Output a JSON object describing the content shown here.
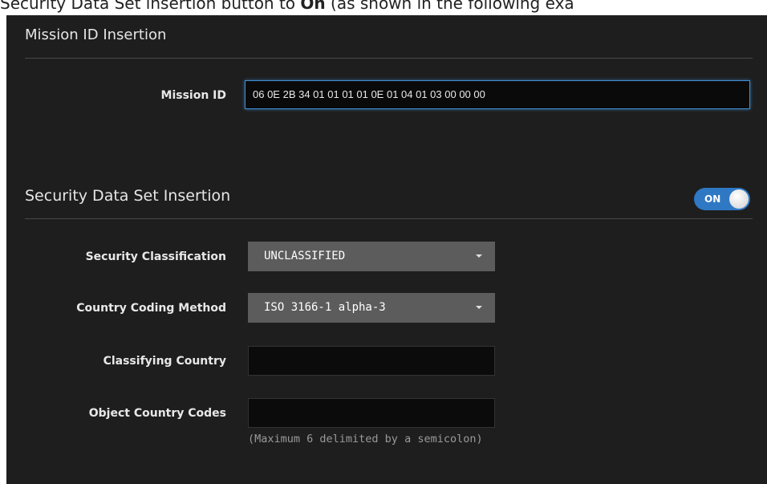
{
  "doc_caption": {
    "prefix": "Security Data Set insertion button to ",
    "bold": "On",
    "suffix": " (as shown in the following exa"
  },
  "mission_section": {
    "title": "Mission ID Insertion",
    "mission_id_label": "Mission ID",
    "mission_id_value": "06 0E 2B 34 01 01 01 01 0E 01 04 01 03 00 00 00"
  },
  "security_section": {
    "title": "Security Data Set Insertion",
    "toggle": {
      "label": "ON",
      "state": "on",
      "color": "#2f78c4"
    },
    "security_classification": {
      "label": "Security Classification",
      "value": "UNCLASSIFIED"
    },
    "country_coding_method": {
      "label": "Country Coding Method",
      "value": "ISO 3166-1 alpha-3"
    },
    "classifying_country": {
      "label": "Classifying Country",
      "value": ""
    },
    "object_country_codes": {
      "label": "Object Country Codes",
      "value": "",
      "hint": "(Maximum 6 delimited by a semicolon)"
    }
  },
  "colors": {
    "panel_background": "#1e1e1e",
    "accent": "#3f8fd6",
    "select_background": "#5c5c5c"
  }
}
